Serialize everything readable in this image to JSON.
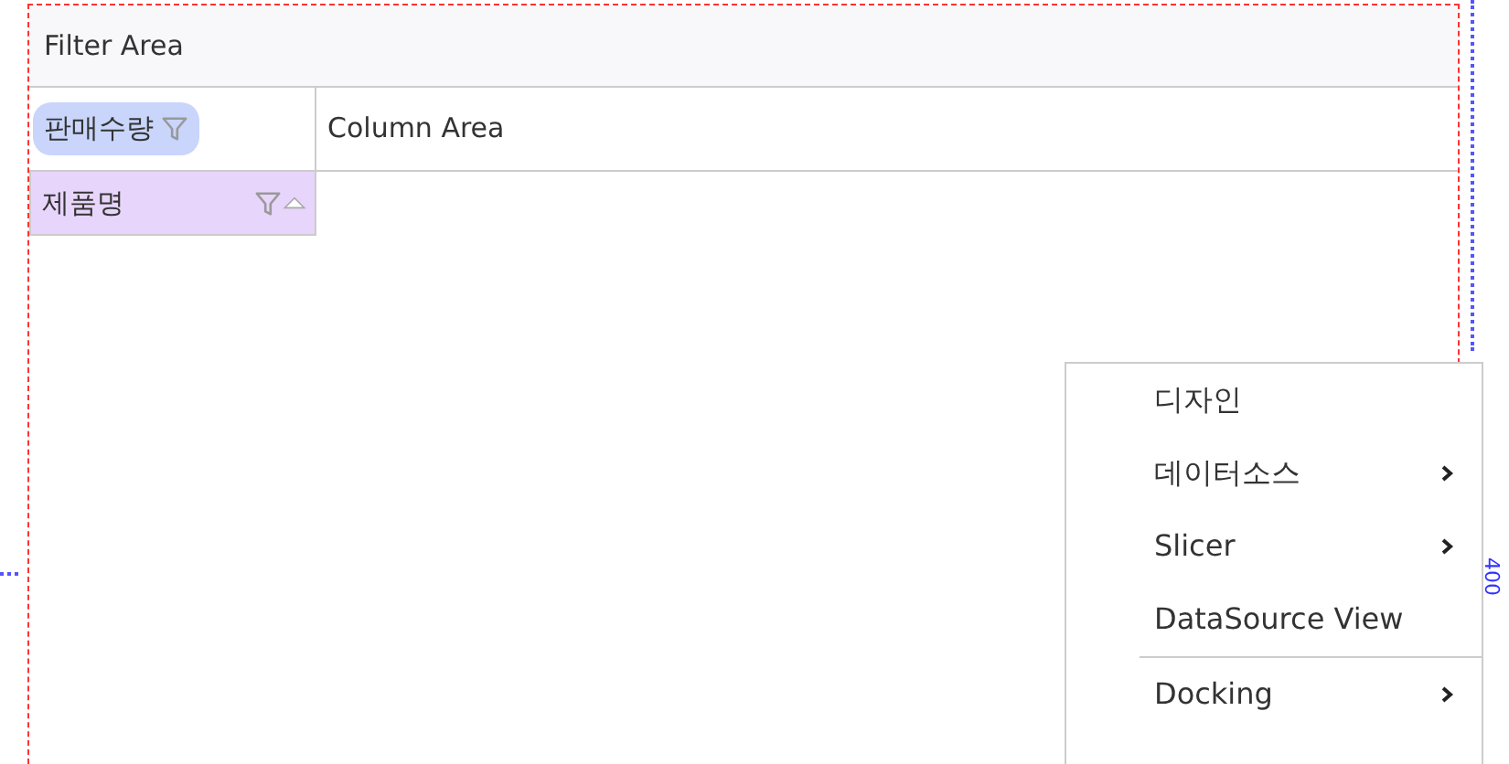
{
  "filter_area": {
    "label": "Filter Area"
  },
  "data_field": {
    "label": "판매수량"
  },
  "column_area": {
    "label": "Column Area"
  },
  "row_fields": [
    {
      "label": "제품명",
      "sorted_ascending": true
    }
  ],
  "context_menu": {
    "items": [
      {
        "label": "디자인",
        "kind": "item",
        "separator_before": false
      },
      {
        "label": "데이터소스",
        "kind": "submenu",
        "separator_before": false
      },
      {
        "label": "Slicer",
        "kind": "submenu",
        "separator_before": false
      },
      {
        "label": "DataSource View",
        "kind": "item",
        "separator_before": false
      },
      {
        "label": "Docking",
        "kind": "submenu",
        "separator_before": true
      }
    ]
  },
  "height_guide": {
    "label": "400"
  }
}
